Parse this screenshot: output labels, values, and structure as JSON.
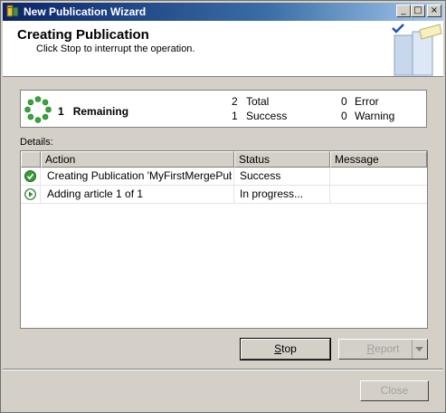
{
  "window": {
    "title": "New Publication Wizard"
  },
  "header": {
    "title": "Creating Publication",
    "subtitle": "Click Stop to interrupt the operation."
  },
  "summary": {
    "remaining_count": "1",
    "remaining_label": "Remaining",
    "total_count": "2",
    "total_label": "Total",
    "success_count": "1",
    "success_label": "Success",
    "error_count": "0",
    "error_label": "Error",
    "warning_count": "0",
    "warning_label": "Warning"
  },
  "details": {
    "label": "Details:",
    "columns": [
      "Action",
      "Status",
      "Message"
    ],
    "rows": [
      {
        "icon": "success-check-icon",
        "action": "Creating Publication 'MyFirstMergePubli...",
        "status": "Success",
        "message": ""
      },
      {
        "icon": "in-progress-arrow-icon",
        "action": "Adding article 1 of 1",
        "status": "In progress...",
        "message": ""
      }
    ]
  },
  "buttons": {
    "stop_first": "S",
    "stop_rest": "top",
    "report_first": "R",
    "report_rest": "eport",
    "close": "Close"
  },
  "colors": {
    "accent": "#0a246a",
    "success": "#3c9a3c",
    "spinner": "#3aa33a"
  }
}
